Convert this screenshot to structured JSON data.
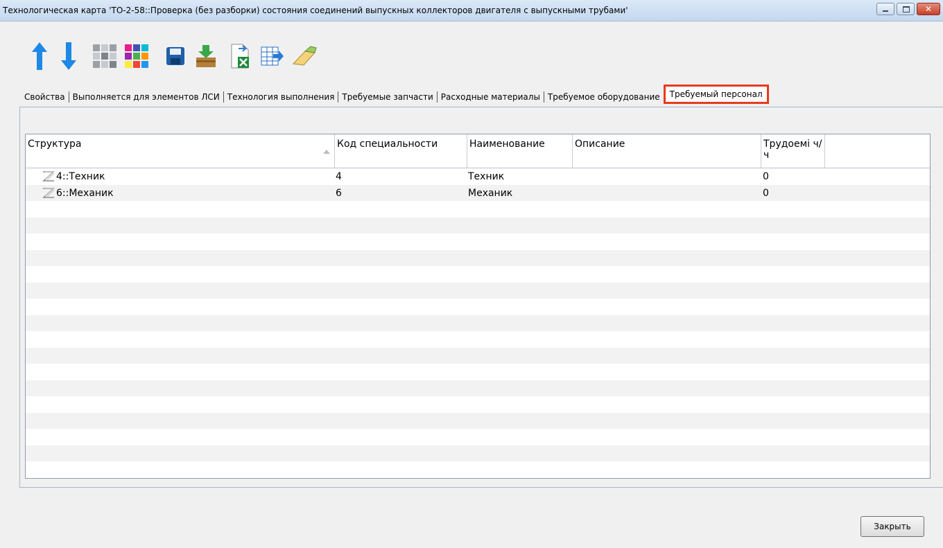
{
  "window": {
    "title": "Технологическая карта 'ТО-2-58::Проверка (без разборки) состояния соединений выпускных коллекторов двигателя с выпускными трубами'",
    "close_glyph": "✕"
  },
  "toolbar": {
    "icons": [
      "arrow-up-icon",
      "arrow-down-icon",
      "gray-grid-icon",
      "color-grid-icon",
      "save-icon",
      "import-icon",
      "excel-export-icon",
      "table-export-icon",
      "eraser-icon"
    ]
  },
  "tabs": [
    {
      "label": "Свойства"
    },
    {
      "label": "Выполняется для элементов ЛСИ"
    },
    {
      "label": "Технология выполнения"
    },
    {
      "label": "Требуемые запчасти"
    },
    {
      "label": "Расходные материалы"
    },
    {
      "label": "Требуемое оборудование"
    },
    {
      "label": "Требуемый персонал",
      "active": true
    }
  ],
  "grid": {
    "columns": [
      {
        "label": "Структура"
      },
      {
        "label": "Код специальности"
      },
      {
        "label": "Наименование"
      },
      {
        "label": "Описание"
      },
      {
        "label": "Трудоемі ч/ч"
      }
    ],
    "rows": [
      {
        "structure": "4::Техник",
        "code": "4",
        "name": "Техник",
        "description": "",
        "labor": "0"
      },
      {
        "structure": "6::Механик",
        "code": "6",
        "name": "Механик",
        "description": "",
        "labor": "0"
      }
    ]
  },
  "footer": {
    "close_label": "Закрыть"
  }
}
